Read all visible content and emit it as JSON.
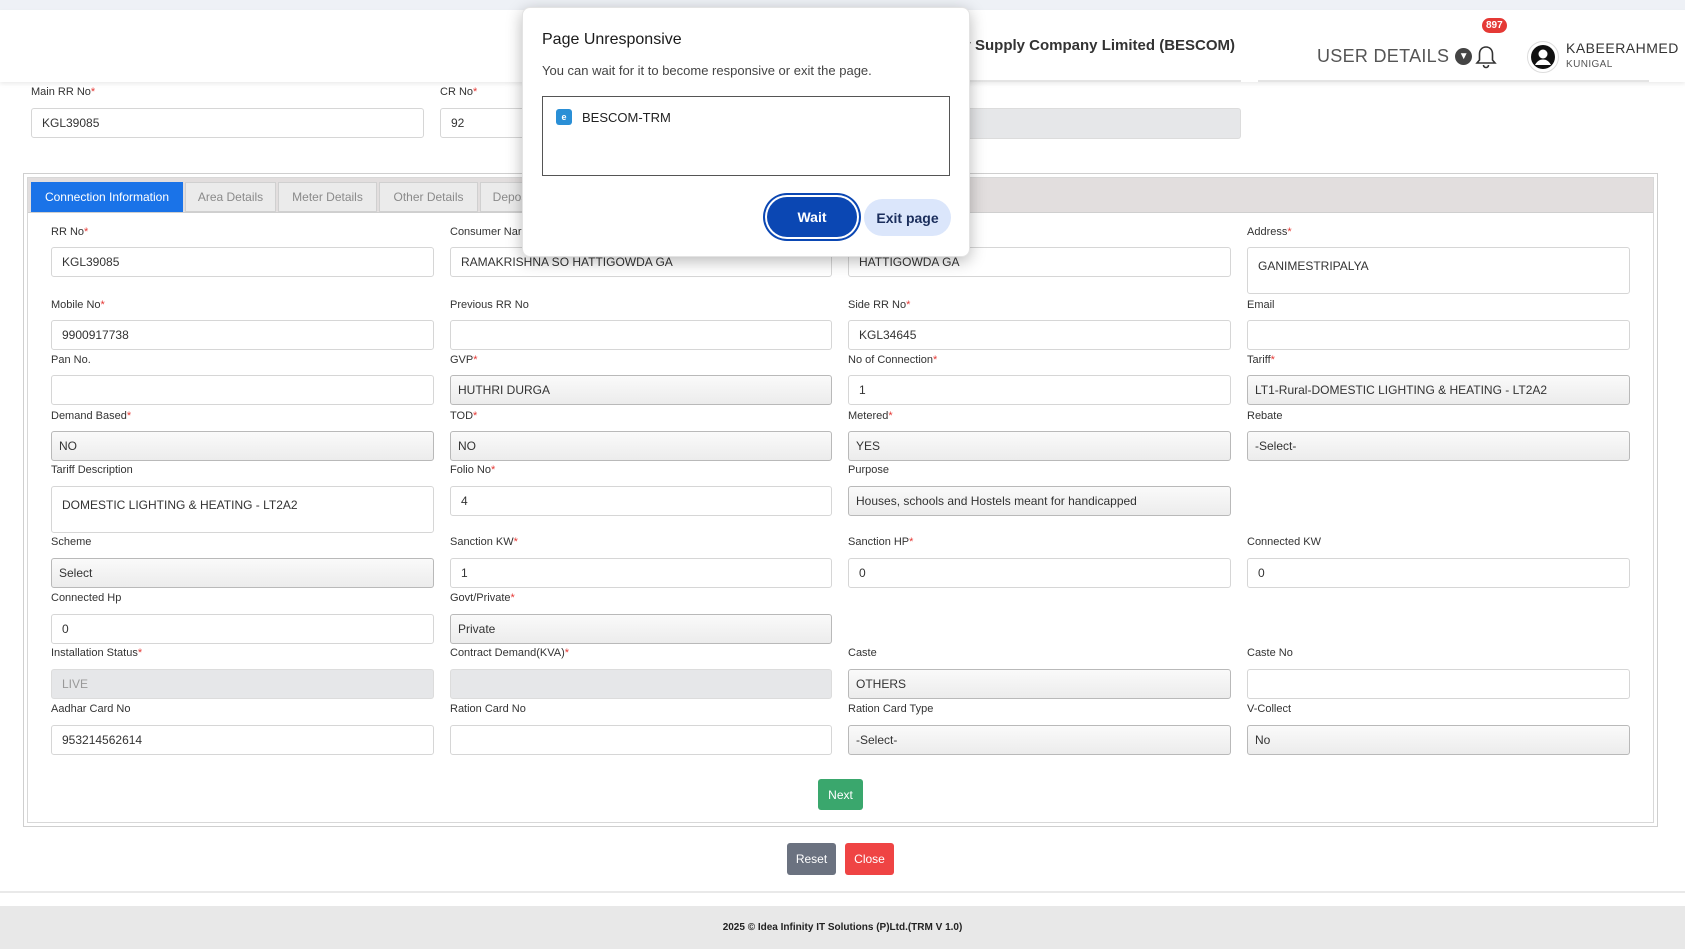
{
  "header": {
    "company": "tricity Supply Company Limited (BESCOM)",
    "user_details": "USER DETAILS",
    "notification_count": "897",
    "username": "KABEERAHMED",
    "location": "KUNIGAL"
  },
  "top_fields": {
    "main_rr_label": "Main RR No",
    "main_rr_value": "KGL39085",
    "cr_label": "CR No",
    "cr_value": "92"
  },
  "tabs": [
    "Connection Information",
    "Area Details",
    "Meter Details",
    "Other Details",
    "Depos"
  ],
  "fields": {
    "rr_no": {
      "label": "RR No",
      "value": "KGL39085"
    },
    "consumer_name": {
      "label": "Consumer Nar",
      "value": "RAMAKRISHNA SO HATTIGOWDA GA"
    },
    "col3_row1": {
      "value": "HATTIGOWDA GA"
    },
    "address": {
      "label": "Address",
      "value": "GANIMESTRIPALYA"
    },
    "mobile_no": {
      "label": "Mobile No",
      "value": "9900917738"
    },
    "previous_rr": {
      "label": "Previous RR No",
      "value": ""
    },
    "side_rr": {
      "label": "Side RR No",
      "value": "KGL34645"
    },
    "email": {
      "label": "Email",
      "value": ""
    },
    "pan_no": {
      "label": "Pan No.",
      "value": ""
    },
    "gvp": {
      "label": "GVP",
      "value": "HUTHRI DURGA"
    },
    "no_of_connection": {
      "label": "No of Connection",
      "value": "1"
    },
    "tariff": {
      "label": "Tariff",
      "value": "LT1-Rural-DOMESTIC LIGHTING & HEATING - LT2A2"
    },
    "demand_based": {
      "label": "Demand Based",
      "value": "NO"
    },
    "tod": {
      "label": "TOD",
      "value": "NO"
    },
    "metered": {
      "label": "Metered",
      "value": "YES"
    },
    "rebate": {
      "label": "Rebate",
      "value": "-Select-"
    },
    "tariff_description": {
      "label": "Tariff Description",
      "value": "DOMESTIC LIGHTING & HEATING - LT2A2"
    },
    "folio_no": {
      "label": "Folio No",
      "value": "4"
    },
    "purpose": {
      "label": "Purpose",
      "value": "Houses, schools and Hostels meant for handicapped"
    },
    "scheme": {
      "label": "Scheme",
      "value": "Select"
    },
    "sanction_kw": {
      "label": "Sanction KW",
      "value": "1"
    },
    "sanction_hp": {
      "label": "Sanction HP",
      "value": "0"
    },
    "connected_kw": {
      "label": "Connected KW",
      "value": "0"
    },
    "connected_hp": {
      "label": "Connected Hp",
      "value": "0"
    },
    "govt_private": {
      "label": "Govt/Private",
      "value": "Private"
    },
    "installation_status": {
      "label": "Installation Status",
      "value": "LIVE"
    },
    "contract_demand": {
      "label": "Contract Demand(KVA)",
      "value": ""
    },
    "caste": {
      "label": "Caste",
      "value": "OTHERS"
    },
    "caste_no": {
      "label": "Caste No",
      "value": ""
    },
    "aadhar": {
      "label": "Aadhar Card No",
      "value": "953214562614"
    },
    "ration_card_no": {
      "label": "Ration Card No",
      "value": ""
    },
    "ration_card_type": {
      "label": "Ration Card Type",
      "value": "-Select-"
    },
    "v_collect": {
      "label": "V-Collect",
      "value": "No"
    }
  },
  "buttons": {
    "next": "Next",
    "reset": "Reset",
    "close": "Close"
  },
  "footer": "2025 © Idea Infinity IT Solutions (P)Ltd.(TRM V 1.0)",
  "dialog": {
    "title": "Page Unresponsive",
    "message": "You can wait for it to become responsive or exit the page.",
    "page_item": "BESCOM-TRM",
    "wait": "Wait",
    "exit": "Exit page"
  },
  "colors": {
    "active_tab": "#1a73e8",
    "next": "#3aa76d",
    "close": "#ef4444",
    "wait": "#0b47b3"
  }
}
